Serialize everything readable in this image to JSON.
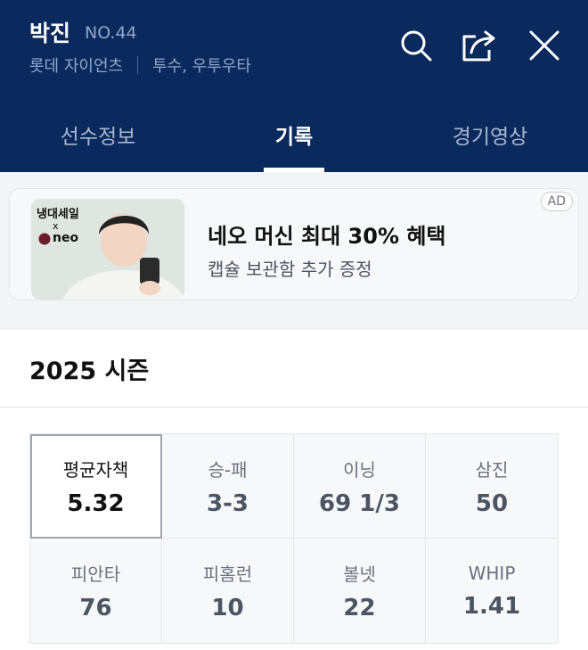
{
  "player": {
    "name": "박진",
    "number": "NO.44",
    "team": "롯데 자이언츠",
    "position": "투수, 우투우타"
  },
  "header": {
    "icons": [
      "search-icon",
      "share-icon",
      "close-icon"
    ]
  },
  "tabs": [
    {
      "label": "선수정보",
      "active": false
    },
    {
      "label": "기록",
      "active": true
    },
    {
      "label": "경기영상",
      "active": false
    }
  ],
  "ad": {
    "badge": "AD",
    "title": "네오 머신 최대 30% 혜택",
    "subtitle": "캡슐 보관함 추가 증정",
    "image_text_top": "냉대세일",
    "image_text_x": "x",
    "image_text_brand": "neo"
  },
  "season": {
    "title": "2025 시즌",
    "stats": [
      {
        "label": "평균자책",
        "value": "5.32",
        "selected": true
      },
      {
        "label": "승-패",
        "value": "3-3"
      },
      {
        "label": "이닝",
        "value": "69 1/3"
      },
      {
        "label": "삼진",
        "value": "50"
      },
      {
        "label": "피안타",
        "value": "76"
      },
      {
        "label": "피홈런",
        "value": "10"
      },
      {
        "label": "볼넷",
        "value": "22"
      },
      {
        "label": "WHIP",
        "value": "1.41"
      }
    ]
  },
  "colors": {
    "header_bg": "#0a2a5e",
    "accent_text": "#93a5c6"
  }
}
